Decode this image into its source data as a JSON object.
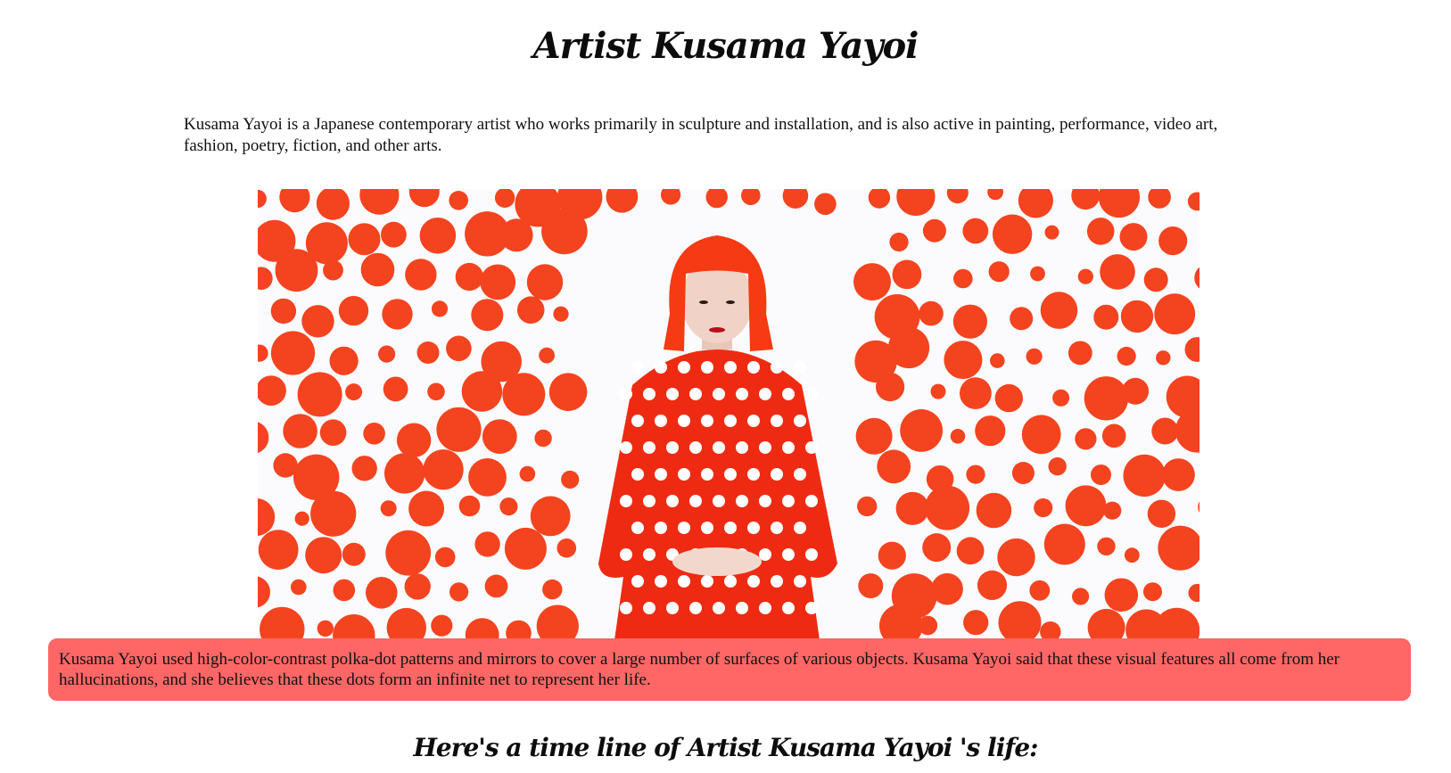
{
  "page": {
    "title": "Artist Kusama Yayoi",
    "intro": "Kusama Yayoi is a Japanese contemporary artist who works primarily in sculpture and installation, and is also active in painting, performance, video art, fashion, poetry, fiction, and other arts.",
    "callout": "Kusama Yayoi used high-color-contrast polka-dot patterns and mirrors to cover a large number of surfaces of various objects. Kusama Yayoi said that these visual features all come from her hallucinations, and she believes that these dots form an infinite net to represent her life.",
    "timeline_heading": "Here's a time line of Artist Kusama Yayoi 's life:"
  },
  "colors": {
    "dot": "#f4431f",
    "hair": "#f53a14",
    "callout_bg": "#ff6766",
    "dress": "#ee2b12"
  },
  "image": {
    "subject": "kusama-portrait-polka-dots"
  }
}
